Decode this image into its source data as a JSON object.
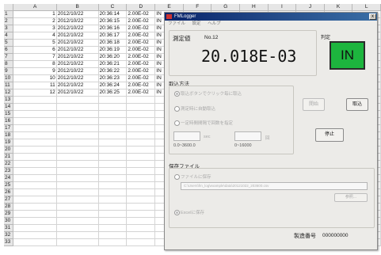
{
  "sheet": {
    "columns": [
      "A",
      "B",
      "C",
      "D",
      "E",
      "F",
      "G",
      "H",
      "I",
      "J",
      "K",
      "L"
    ],
    "rows": [
      {
        "n": "1",
        "a": "1",
        "b": "2012/10/22",
        "c": "20:36:14",
        "d": "2.00E-02",
        "e": "IN"
      },
      {
        "n": "2",
        "a": "2",
        "b": "2012/10/22",
        "c": "20:36:15",
        "d": "2.00E-02",
        "e": "IN"
      },
      {
        "n": "3",
        "a": "3",
        "b": "2012/10/22",
        "c": "20:36:16",
        "d": "2.00E-02",
        "e": "IN"
      },
      {
        "n": "4",
        "a": "4",
        "b": "2012/10/22",
        "c": "20:36:17",
        "d": "2.00E-02",
        "e": "IN"
      },
      {
        "n": "5",
        "a": "5",
        "b": "2012/10/22",
        "c": "20:36:18",
        "d": "2.00E-02",
        "e": "IN"
      },
      {
        "n": "6",
        "a": "6",
        "b": "2012/10/22",
        "c": "20:36:19",
        "d": "2.00E-02",
        "e": "IN"
      },
      {
        "n": "7",
        "a": "7",
        "b": "2012/10/22",
        "c": "20:36:20",
        "d": "2.00E-02",
        "e": "IN"
      },
      {
        "n": "8",
        "a": "8",
        "b": "2012/10/22",
        "c": "20:36:21",
        "d": "2.00E-02",
        "e": "IN"
      },
      {
        "n": "9",
        "a": "9",
        "b": "2012/10/22",
        "c": "20:36:22",
        "d": "2.00E-02",
        "e": "IN"
      },
      {
        "n": "10",
        "a": "10",
        "b": "2012/10/22",
        "c": "20:36:23",
        "d": "2.00E-02",
        "e": "IN"
      },
      {
        "n": "11",
        "a": "11",
        "b": "2012/10/22",
        "c": "20:36:24",
        "d": "2.00E-02",
        "e": "IN"
      },
      {
        "n": "12",
        "a": "12",
        "b": "2012/10/22",
        "c": "20:36:25",
        "d": "2.00E-02",
        "e": "IN"
      },
      {
        "n": "13"
      },
      {
        "n": "14"
      },
      {
        "n": "15"
      },
      {
        "n": "16"
      },
      {
        "n": "17"
      },
      {
        "n": "18"
      },
      {
        "n": "19"
      },
      {
        "n": "20"
      },
      {
        "n": "21"
      },
      {
        "n": "22"
      },
      {
        "n": "23"
      },
      {
        "n": "24"
      },
      {
        "n": "25"
      },
      {
        "n": "26"
      },
      {
        "n": "27"
      },
      {
        "n": "28"
      },
      {
        "n": "29"
      },
      {
        "n": "30"
      },
      {
        "n": "31"
      },
      {
        "n": "32"
      },
      {
        "n": "33"
      }
    ]
  },
  "logger": {
    "title": "FMLogger",
    "close": "x",
    "menu": [
      "ファイル",
      "設定",
      "ヘルプ"
    ],
    "measure_label": "測定値",
    "measure_no": "No.12",
    "value": "20.018E-03",
    "judge_label": "判定",
    "judge_value": "IN",
    "judge_color": "#1db53e",
    "capture_method": "取込方法",
    "opt1": "取込ボタンでクリック毎に取込",
    "opt2": "測定時に自動取込",
    "opt3": "一定時間間隔で回数を指定",
    "sec_label": "sec",
    "count_label": "回",
    "sec_range": "0.0~3600.0",
    "count_range": "0~16000",
    "start_btn": "開始",
    "capture_btn": "取込",
    "stop_btn": "停止",
    "save_file": "保存ファイル",
    "file_opt": "ファイルに保存",
    "file_path": "C:\\Users\\fm_log\\example\\data\\20121022_203600.csv",
    "browse_btn": "参照...",
    "excel_opt": "Excelに保存",
    "serial_label": "製造番号",
    "serial_value": "000000000"
  }
}
